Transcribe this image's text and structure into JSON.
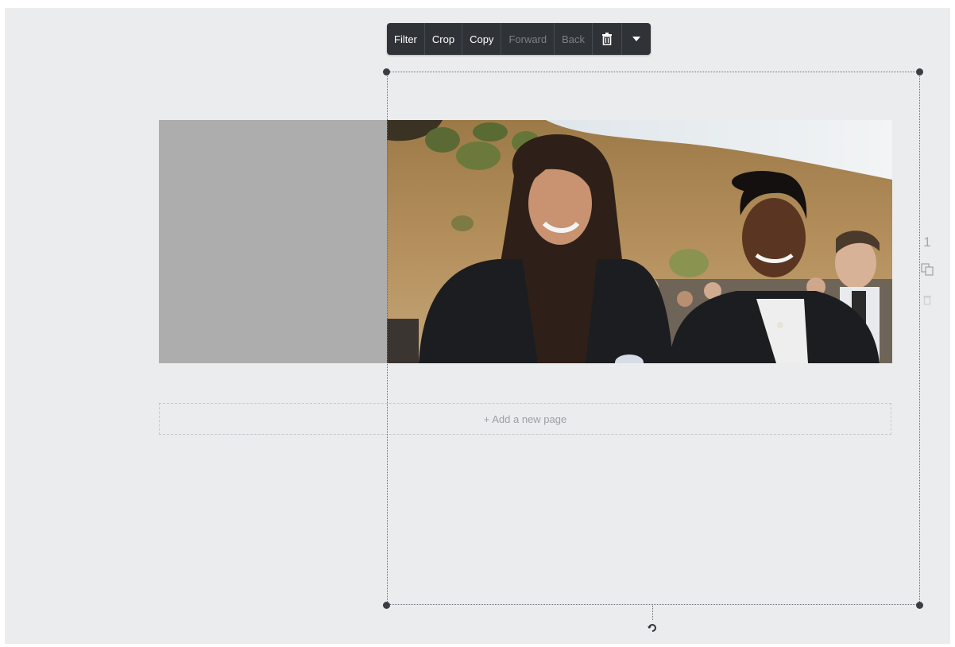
{
  "toolbar": {
    "filter_label": "Filter",
    "crop_label": "Crop",
    "copy_label": "Copy",
    "forward_label": "Forward",
    "back_label": "Back",
    "delete_icon": "trash-icon",
    "more_icon": "caret-down-icon"
  },
  "page": {
    "add_page_label": "+ Add a new page",
    "page_number": "1",
    "duplicate_icon": "copy-page-icon",
    "delete_icon": "delete-page-icon"
  },
  "selection": {
    "rotate_icon": "rotate-icon"
  },
  "colors": {
    "canvas_bg": "#ebeced",
    "toolbar_bg": "#2f3338",
    "page_placeholder": "#adadad"
  }
}
